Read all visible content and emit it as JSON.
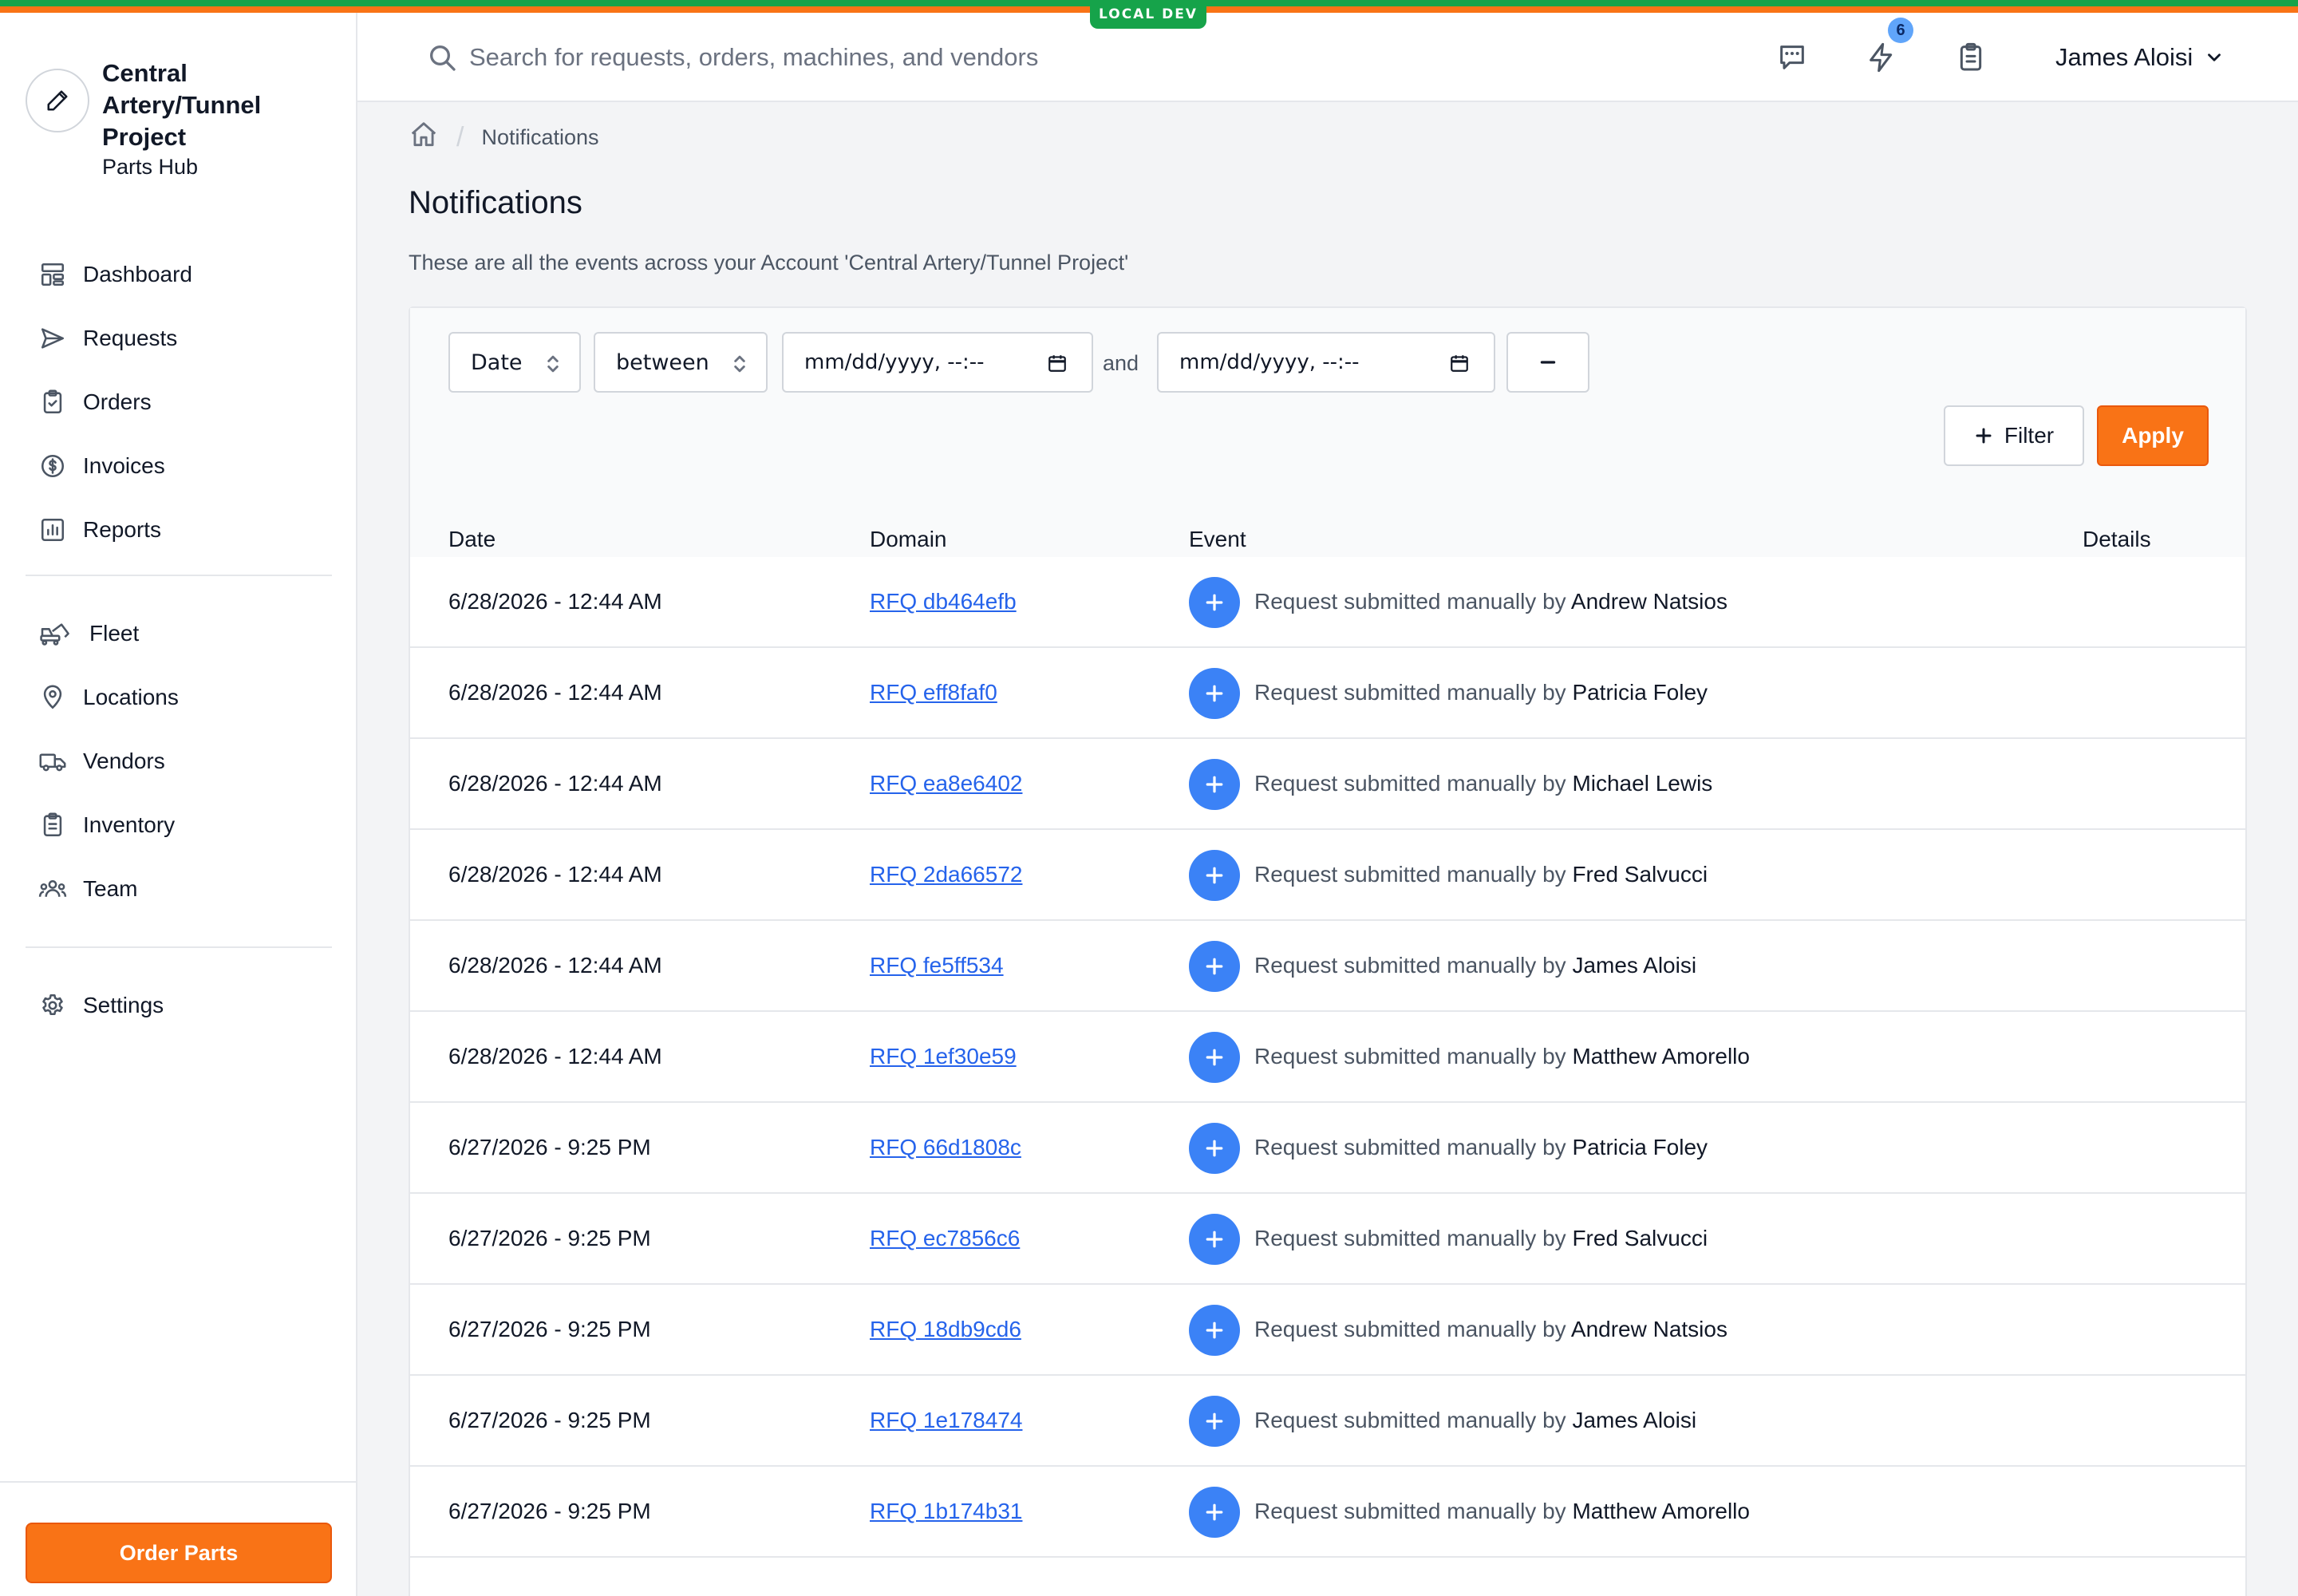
{
  "env_badge": "LOCAL DEV",
  "brand": {
    "name": "Central Artery/Tunnel Project",
    "subtitle": "Parts Hub",
    "logo_icon": "pencil-icon"
  },
  "sidebar": {
    "primary": [
      {
        "label": "Dashboard",
        "icon": "dashboard-icon"
      },
      {
        "label": "Requests",
        "icon": "send-icon"
      },
      {
        "label": "Orders",
        "icon": "clipboard-check-icon"
      },
      {
        "label": "Invoices",
        "icon": "dollar-icon"
      },
      {
        "label": "Reports",
        "icon": "chart-icon"
      }
    ],
    "secondary": [
      {
        "label": "Fleet",
        "icon": "excavator-icon"
      },
      {
        "label": "Locations",
        "icon": "location-pin-icon"
      },
      {
        "label": "Vendors",
        "icon": "truck-icon"
      },
      {
        "label": "Inventory",
        "icon": "clipboard-list-icon"
      },
      {
        "label": "Team",
        "icon": "team-icon"
      }
    ],
    "tertiary": [
      {
        "label": "Settings",
        "icon": "gear-icon"
      }
    ],
    "order_button": "Order Parts"
  },
  "header": {
    "search_placeholder": "Search for requests, orders, machines, and vendors",
    "notification_count": "6",
    "user_name": "James Aloisi"
  },
  "breadcrumb": {
    "current": "Notifications"
  },
  "page": {
    "title": "Notifications",
    "description": "These are all the events across your Account 'Central Artery/Tunnel Project'"
  },
  "filter": {
    "field": "Date",
    "operator": "between",
    "start_placeholder": "mm/dd/yyyy, --:--",
    "and_label": "and",
    "end_placeholder": "mm/dd/yyyy, --:--",
    "add_filter_label": "Filter",
    "apply_label": "Apply"
  },
  "table": {
    "columns": [
      "Date",
      "Domain",
      "Event",
      "Details"
    ],
    "event_prefix": "Request submitted manually by ",
    "rows": [
      {
        "date": "6/28/2026 - 12:44 AM",
        "domain": "RFQ db464efb",
        "person": "Andrew Natsios"
      },
      {
        "date": "6/28/2026 - 12:44 AM",
        "domain": "RFQ eff8faf0",
        "person": "Patricia Foley"
      },
      {
        "date": "6/28/2026 - 12:44 AM",
        "domain": "RFQ ea8e6402",
        "person": "Michael Lewis"
      },
      {
        "date": "6/28/2026 - 12:44 AM",
        "domain": "RFQ 2da66572",
        "person": "Fred Salvucci"
      },
      {
        "date": "6/28/2026 - 12:44 AM",
        "domain": "RFQ fe5ff534",
        "person": "James Aloisi"
      },
      {
        "date": "6/28/2026 - 12:44 AM",
        "domain": "RFQ 1ef30e59",
        "person": "Matthew Amorello"
      },
      {
        "date": "6/27/2026 - 9:25 PM",
        "domain": "RFQ 66d1808c",
        "person": "Patricia Foley"
      },
      {
        "date": "6/27/2026 - 9:25 PM",
        "domain": "RFQ ec7856c6",
        "person": "Fred Salvucci"
      },
      {
        "date": "6/27/2026 - 9:25 PM",
        "domain": "RFQ 18db9cd6",
        "person": "Andrew Natsios"
      },
      {
        "date": "6/27/2026 - 9:25 PM",
        "domain": "RFQ 1e178474",
        "person": "James Aloisi"
      },
      {
        "date": "6/27/2026 - 9:25 PM",
        "domain": "RFQ 1b174b31",
        "person": "Matthew Amorello"
      }
    ]
  },
  "colors": {
    "accent_orange": "#f97316",
    "accent_green": "#16a34a",
    "link_blue": "#2563eb",
    "event_icon_blue": "#3b82f6"
  }
}
